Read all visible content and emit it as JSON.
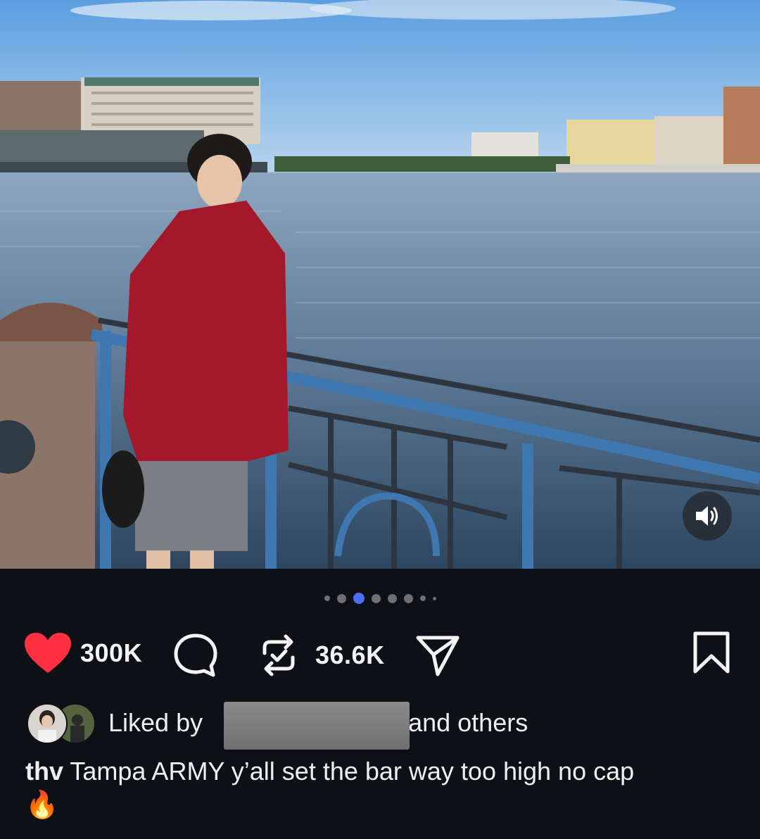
{
  "post": {
    "carousel": {
      "total": 8,
      "active_index": 2
    },
    "like_count": "300K",
    "repost_count": "36.6K",
    "liked_by_prefix": "Liked by",
    "liked_by_suffix": "and others",
    "caption_user": "thv",
    "caption_text": "Tampa ARMY y’all set the bar way too high no cap",
    "caption_emoji": "🔥"
  },
  "icons": {
    "like": "heart-icon",
    "comment": "comment-icon",
    "repost": "repost-icon",
    "share": "send-icon",
    "save": "bookmark-icon",
    "sound": "speaker-icon"
  },
  "colors": {
    "background": "#0d1014",
    "like": "#ff3040",
    "active_dot": "#4f6ef7"
  }
}
